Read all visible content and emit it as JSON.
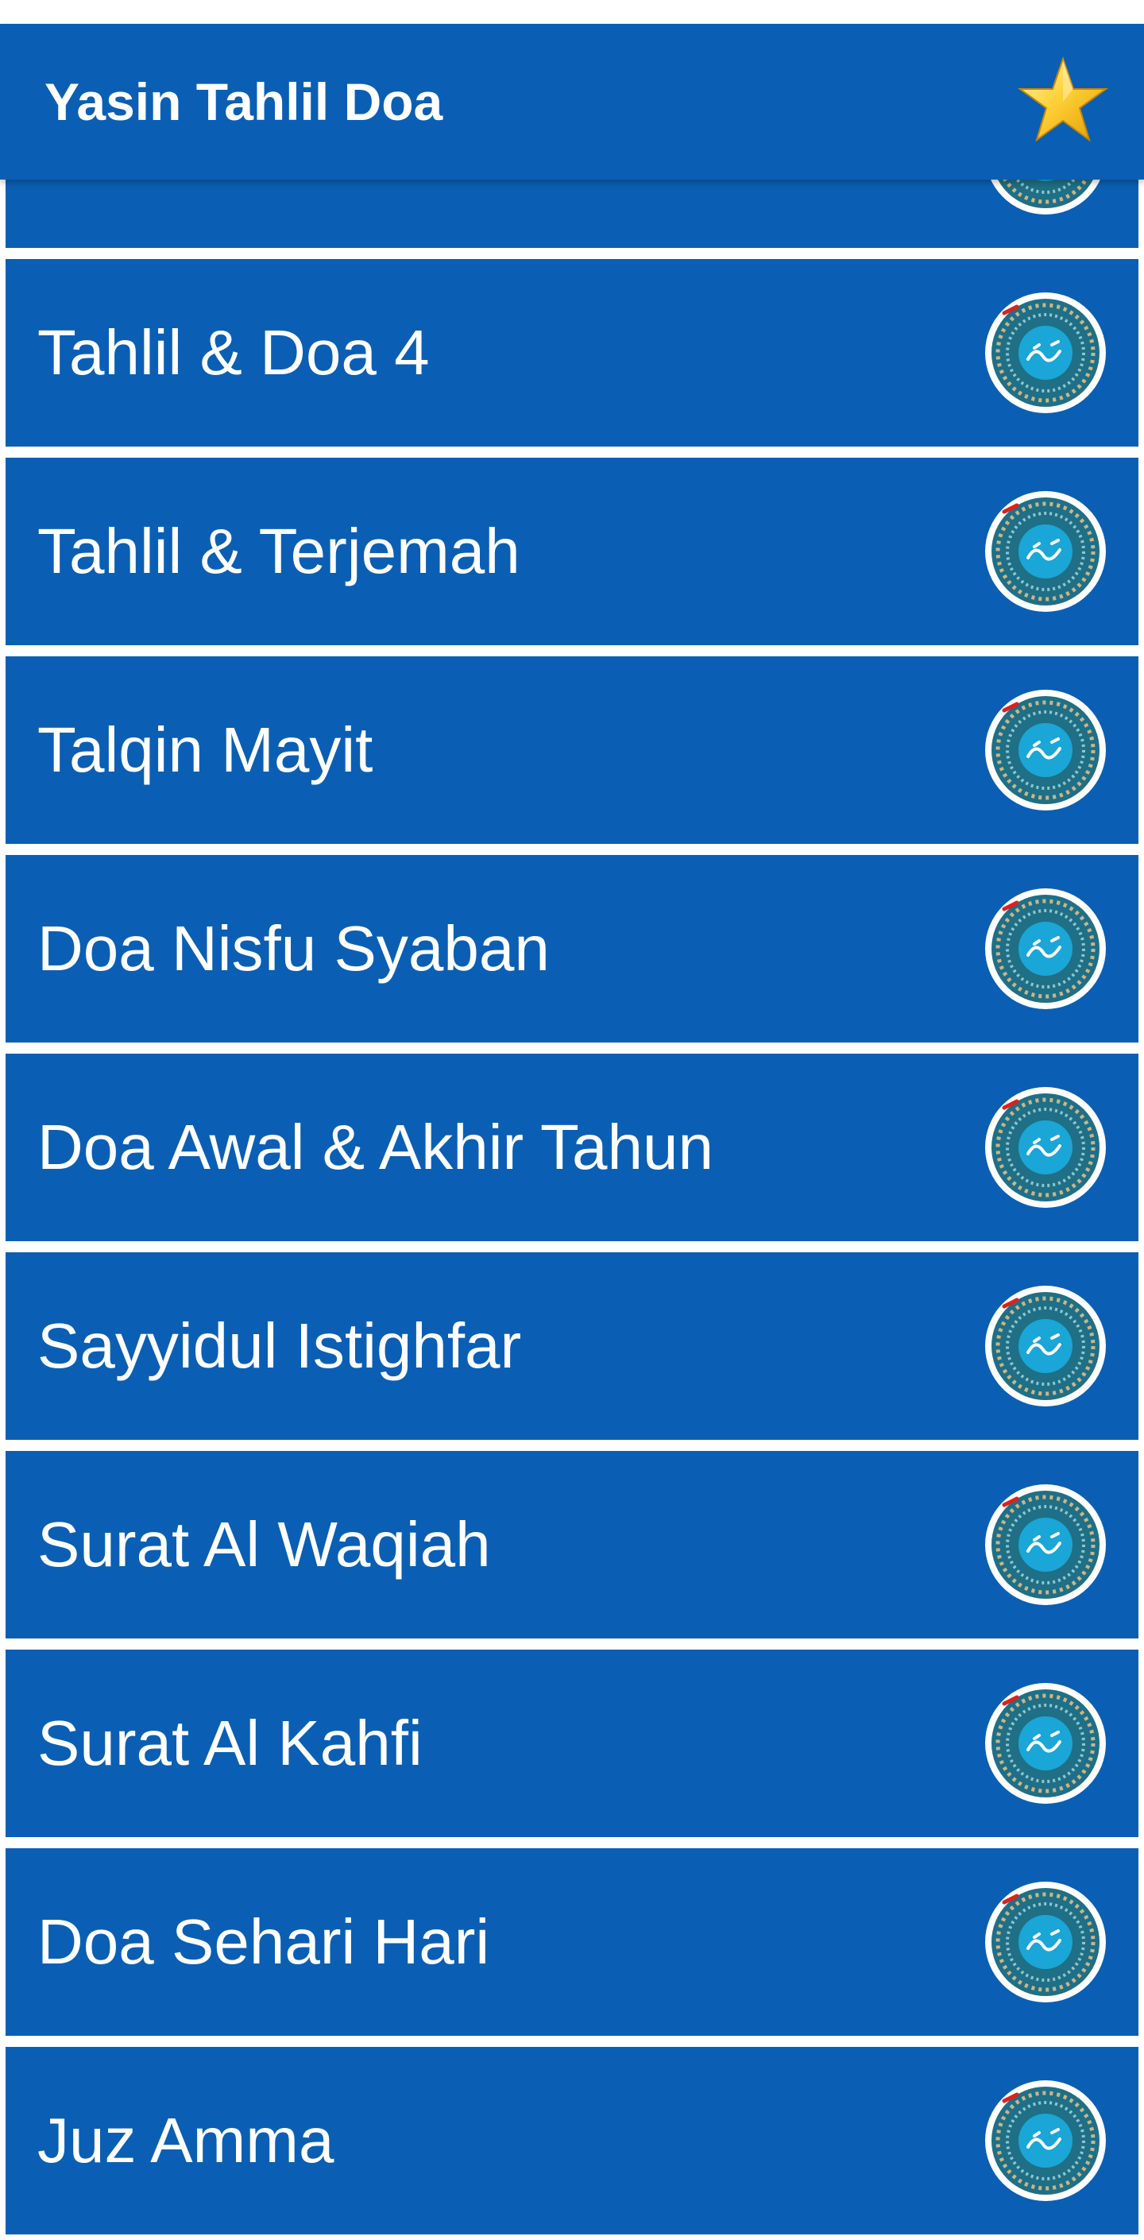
{
  "app_bar": {
    "title": "Yasin Tahlil Doa",
    "action_icon": "star-icon",
    "background": "#0a5fb4"
  },
  "list": {
    "item_background": "#0a5fb4",
    "item_text_color": "#ffffff",
    "item_icon": "yasin-medallion-icon",
    "items": [
      {
        "label": ""
      },
      {
        "label": "Tahlil & Doa 4"
      },
      {
        "label": "Tahlil & Terjemah"
      },
      {
        "label": "Talqin Mayit"
      },
      {
        "label": "Doa Nisfu Syaban"
      },
      {
        "label": "Doa Awal & Akhir Tahun"
      },
      {
        "label": "Sayyidul Istighfar"
      },
      {
        "label": "Surat Al Waqiah"
      },
      {
        "label": "Surat Al Kahfi"
      },
      {
        "label": "Doa Sehari Hari"
      },
      {
        "label": "Juz Amma"
      }
    ]
  }
}
